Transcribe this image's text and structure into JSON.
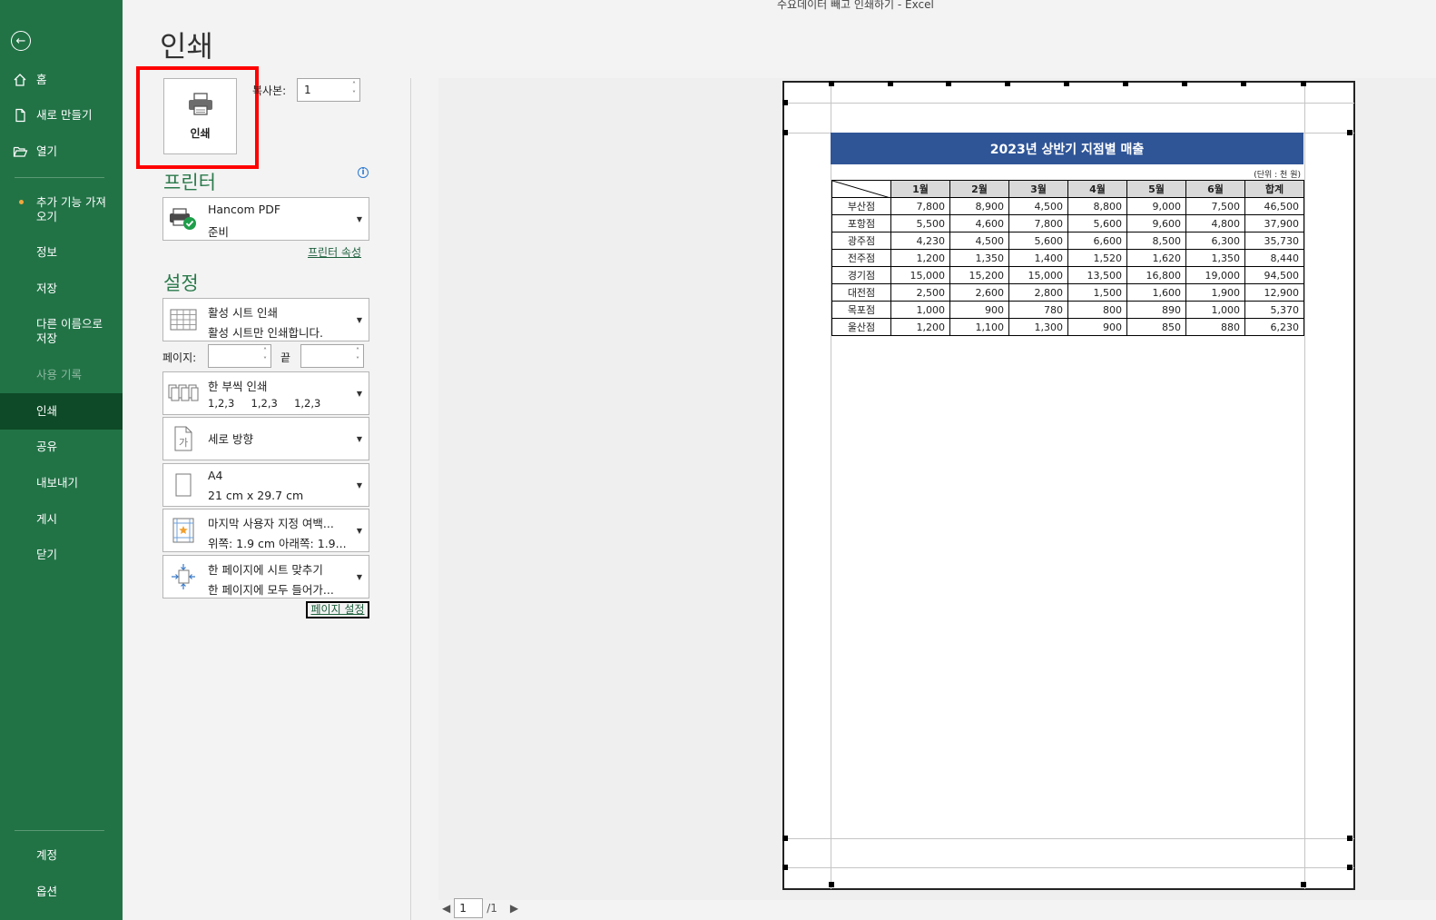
{
  "window": {
    "title": "수요데이터 빼고 인쇄하기  -  Excel"
  },
  "sidebar": {
    "items": [
      {
        "label": "홈",
        "icon": "home-icon"
      },
      {
        "label": "새로 만들기",
        "icon": "new-document-icon"
      },
      {
        "label": "열기",
        "icon": "folder-open-icon"
      },
      {
        "label": "추가 기능 가져\n오기"
      },
      {
        "label": "정보"
      },
      {
        "label": "저장"
      },
      {
        "label": "다른 이름으로\n저장"
      },
      {
        "label": "사용 기록"
      },
      {
        "label": "인쇄"
      },
      {
        "label": "공유"
      },
      {
        "label": "내보내기"
      },
      {
        "label": "게시"
      },
      {
        "label": "닫기"
      },
      {
        "label": "계정"
      },
      {
        "label": "옵션"
      }
    ]
  },
  "print_panel": {
    "title": "인쇄",
    "print_button_label": "인쇄",
    "copies_label": "복사본:",
    "copies_value": "1",
    "printer_section_title": "프린터",
    "printer_name": "Hancom PDF",
    "printer_status": "준비",
    "printer_properties_link": "프린터 속성",
    "settings_section_title": "설정",
    "settings": [
      {
        "line1": "활성 시트 인쇄",
        "line2": "활성 시트만 인쇄합니다."
      },
      {
        "line1": "한 부씩 인쇄",
        "line2": "1,2,3     1,2,3     1,2,3"
      },
      {
        "line1": "세로 방향",
        "line2": ""
      },
      {
        "line1": "A4",
        "line2": "21 cm x 29.7 cm"
      },
      {
        "line1": "마지막 사용자 지정 여백...",
        "line2": "위쪽: 1.9 cm 아래쪽: 1.9..."
      },
      {
        "line1": "한 페이지에 시트 맞추기",
        "line2": "한 페이지에 모두 들어가..."
      }
    ],
    "pages_label": "페이지:",
    "pages_to_label": "끝",
    "page_setup_link": "페이지 설정"
  },
  "preview": {
    "sheet_title": "2023년 상반기 지점별 매출",
    "unit_note": "(단위 : 천 원)",
    "columns": [
      "1월",
      "2월",
      "3월",
      "4월",
      "5월",
      "6월",
      "합계"
    ],
    "rows": [
      {
        "name": "부산점",
        "values": [
          "7,800",
          "8,900",
          "4,500",
          "8,800",
          "9,000",
          "7,500",
          "46,500"
        ]
      },
      {
        "name": "포항점",
        "values": [
          "5,500",
          "4,600",
          "7,800",
          "5,600",
          "9,600",
          "4,800",
          "37,900"
        ]
      },
      {
        "name": "광주점",
        "values": [
          "4,230",
          "4,500",
          "5,600",
          "6,600",
          "8,500",
          "6,300",
          "35,730"
        ]
      },
      {
        "name": "전주점",
        "values": [
          "1,200",
          "1,350",
          "1,400",
          "1,520",
          "1,620",
          "1,350",
          "8,440"
        ]
      },
      {
        "name": "경기점",
        "values": [
          "15,000",
          "15,200",
          "15,000",
          "13,500",
          "16,800",
          "19,000",
          "94,500"
        ]
      },
      {
        "name": "대전점",
        "values": [
          "2,500",
          "2,600",
          "2,800",
          "1,500",
          "1,600",
          "1,900",
          "12,900"
        ]
      },
      {
        "name": "목포점",
        "values": [
          "1,000",
          "900",
          "780",
          "800",
          "890",
          "1,000",
          "5,370"
        ]
      },
      {
        "name": "울산점",
        "values": [
          "1,200",
          "1,100",
          "1,300",
          "900",
          "850",
          "880",
          "6,230"
        ]
      }
    ],
    "current_page": "1",
    "total_pages": "/1"
  },
  "colors": {
    "sidebar_bg": "#217346",
    "sidebar_active": "#0e4a27",
    "accent_green": "#2a7a4b",
    "title_bar_blue": "#2f5597",
    "highlight_red": "#ff0000"
  }
}
